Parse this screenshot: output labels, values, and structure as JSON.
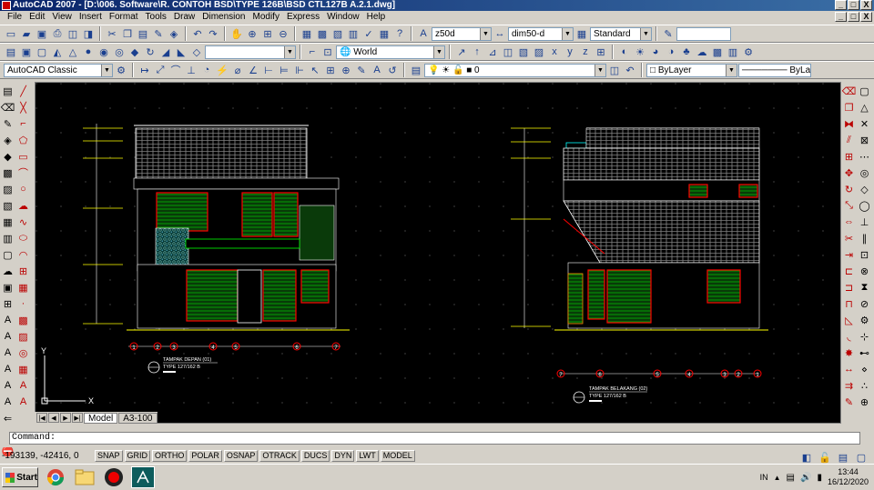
{
  "window": {
    "title": "AutoCAD 2007 - [D:\\006. Software\\R. CONTOH BSD\\TYPE 126B\\BSD CTL127B A.2.1.dwg]",
    "minimize": "_",
    "maximize": "□",
    "close": "X"
  },
  "menu": [
    "File",
    "Edit",
    "View",
    "Insert",
    "Format",
    "Tools",
    "Draw",
    "Dimension",
    "Modify",
    "Express",
    "Window",
    "Help"
  ],
  "toolbar1": {
    "dimstyle": "z50d",
    "textstyle": "dim50-d",
    "tablestyle": "Standard"
  },
  "toolbar2": {
    "ucs": "World"
  },
  "toolbar3": {
    "workspace": "AutoCAD Classic",
    "layer": "0",
    "color": "ByLayer",
    "linetype": "ByLayer"
  },
  "drawing": {
    "front_title": "TAMPAK DEPAN (01)",
    "front_subtitle": "TYPE 127/162 B",
    "back_title": "TAMPAK BELAKANG (02)",
    "back_subtitle": "TYPE 127/162 B",
    "front_grid": [
      "1",
      "2",
      "3",
      "4",
      "5",
      "6",
      "7"
    ],
    "back_grid": [
      "7",
      "6",
      "5",
      "4",
      "3",
      "2",
      "1"
    ],
    "ucs_x": "X",
    "ucs_y": "Y"
  },
  "tabs": {
    "model": "Model",
    "layout": "A3-100"
  },
  "command": {
    "prompt": "Command:"
  },
  "status": {
    "coords": "-193139, -42416, 0",
    "buttons": [
      "SNAP",
      "GRID",
      "ORTHO",
      "POLAR",
      "OSNAP",
      "OTRACK",
      "DUCS",
      "DYN",
      "LWT",
      "MODEL"
    ]
  },
  "taskbar": {
    "start": "Start",
    "language": "IN",
    "time": "13:44",
    "date": "16/12/2020"
  },
  "colors": {
    "title_start": "#0a246a",
    "title_end": "#3a6ea5",
    "canvas": "#000000",
    "cad_green": "#00ff00",
    "cad_red": "#ff0000",
    "cad_cyan": "#00ffff",
    "cad_white": "#ffffff"
  }
}
